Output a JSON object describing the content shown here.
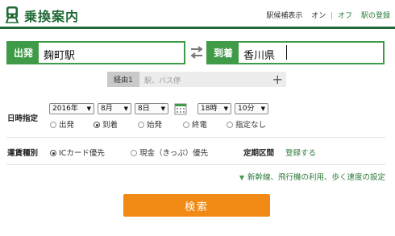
{
  "header": {
    "title": "乗換案内",
    "station_info_label": "駅候補表示",
    "toggle_on": "オン",
    "toggle_separator": "|",
    "toggle_off": "オフ",
    "register_link": "駅の登録"
  },
  "route": {
    "from_label": "出発",
    "from_value": "麹町駅",
    "to_label": "到着",
    "to_value": "香川県",
    "via_label": "経由1",
    "via_placeholder": "駅、バス停",
    "via_add": "+"
  },
  "datetime": {
    "label": "日時指定",
    "year": "2016年",
    "month": "8月",
    "day": "8日",
    "hour": "18時",
    "minute": "10分",
    "options": [
      "出発",
      "到着",
      "始発",
      "終電",
      "指定なし"
    ],
    "selected": "到着"
  },
  "fare": {
    "label": "運賃種別",
    "options": [
      "ICカード優先",
      "現金（きっぷ）優先"
    ],
    "selected": "ICカード優先",
    "commuter_label": "定期区間",
    "commuter_link": "登録する"
  },
  "settings": {
    "link": "新幹線、飛行機の利用、歩く速度の設定"
  },
  "search_button": "検索",
  "icons": [
    "train-icon",
    "swap-icon",
    "calendar-icon",
    "plus-icon"
  ],
  "colors": {
    "brand_green": "#1f6a36",
    "label_green": "#3f9b48",
    "button_orange": "#f08a14",
    "link_green": "#2a7a3b"
  }
}
